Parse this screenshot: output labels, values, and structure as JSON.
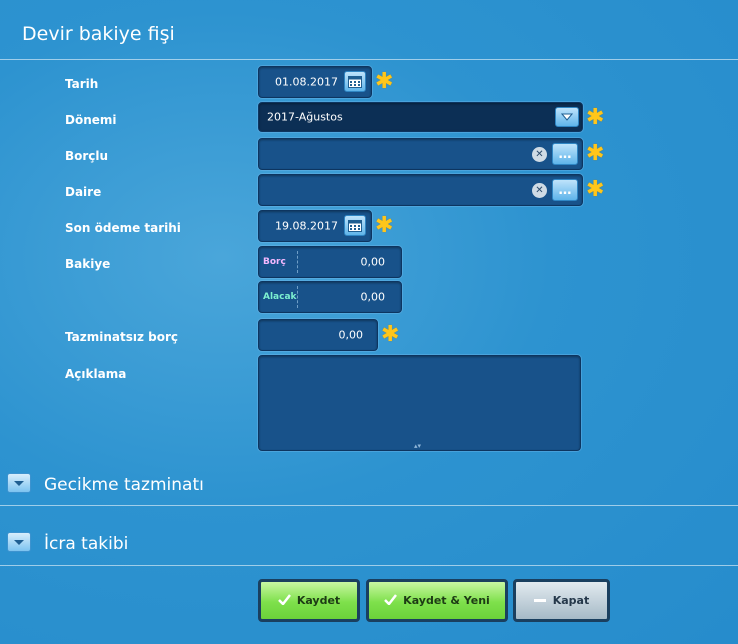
{
  "header": {
    "title": "Devir bakiye fişi"
  },
  "form": {
    "tarih": {
      "label": "Tarih",
      "value": "01.08.2017"
    },
    "donemi": {
      "label": "Dönemi",
      "value": "2017-Ağustos"
    },
    "borclu": {
      "label": "Borçlu",
      "value": ""
    },
    "daire": {
      "label": "Daire",
      "value": ""
    },
    "son_odeme": {
      "label": "Son ödeme tarihi",
      "value": "19.08.2017"
    },
    "bakiye": {
      "label": "Bakiye",
      "borc_tag": "Borç",
      "borc_value": "0,00",
      "alacak_tag": "Alacak",
      "alacak_value": "0,00"
    },
    "tazminatsiz": {
      "label": "Tazminatsız borç",
      "value": "0,00"
    },
    "aciklama": {
      "label": "Açıklama",
      "value": ""
    }
  },
  "sections": [
    {
      "title": "Gecikme tazminatı"
    },
    {
      "title": "İcra takibi"
    }
  ],
  "buttons": {
    "kaydet": "Kaydet",
    "kaydet_yeni": "Kaydet & Yeni",
    "kapat": "Kapat"
  },
  "colors": {
    "required_star": "#ffc61a",
    "borc_tag": "#f4b8ff",
    "alacak_tag": "#7df0d0"
  },
  "icons": [
    "calendar-icon",
    "dropdown-arrow-icon",
    "clear-icon",
    "ellipsis-icon",
    "required-star-icon",
    "expand-icon",
    "check-icon",
    "minus-icon"
  ]
}
